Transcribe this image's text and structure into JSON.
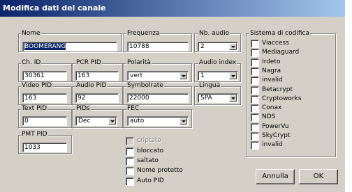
{
  "window": {
    "title": "Modifica dati del canale"
  },
  "fields": {
    "nome": {
      "label": "Nome",
      "value": "BOOMERANG"
    },
    "frequenza": {
      "label": "Frequenza",
      "value": "10788"
    },
    "nb_audio": {
      "label": "Nb. audio",
      "value": "2"
    },
    "ch_id": {
      "label": "Ch. ID",
      "value": "30361"
    },
    "pcr_pid": {
      "label": "PCR PID",
      "value": "163"
    },
    "polarita": {
      "label": "Polarità",
      "value": "vert"
    },
    "audio_index": {
      "label": "Audio index",
      "value": "1"
    },
    "video_pid": {
      "label": "Video PID",
      "value": "163"
    },
    "audio_pid": {
      "label": "Audio PID",
      "value": "92"
    },
    "symbolrate": {
      "label": "Symbolrate",
      "value": "22000"
    },
    "lingua": {
      "label": "Lingua",
      "value": "SPA"
    },
    "text_pid": {
      "label": "Text PID",
      "value": "0"
    },
    "pids": {
      "label": "PIDs",
      "value": "Dec"
    },
    "fec": {
      "label": "FEC",
      "value": "auto"
    },
    "pmt_pid": {
      "label": "PMT PID",
      "value": "1033"
    }
  },
  "flags": [
    {
      "label": "criptato",
      "checked": false,
      "enabled": false
    },
    {
      "label": "bloccato",
      "checked": false,
      "enabled": true
    },
    {
      "label": "saltato",
      "checked": false,
      "enabled": true
    },
    {
      "label": "Nome protetto",
      "checked": false,
      "enabled": true
    },
    {
      "label": "Auto PID",
      "checked": false,
      "enabled": true
    }
  ],
  "encoding": {
    "title": "Sistema di codifica",
    "items": [
      "Viaccess",
      "Mediaguard",
      "Irdeto",
      "Nagra",
      "invalid",
      "Betacrypt",
      "Cryptoworks",
      "Conax",
      "NDS",
      "PowerVu",
      "SkyCrypt",
      "invalid"
    ]
  },
  "buttons": {
    "cancel": "Annulla",
    "ok": "OK"
  }
}
